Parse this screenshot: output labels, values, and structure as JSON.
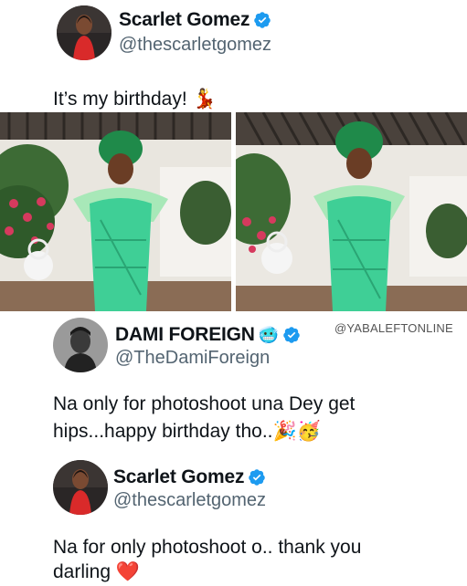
{
  "tweet1": {
    "name": "Scarlet Gomez",
    "handle": "@thescarletgomez",
    "text": "It’s my birthday! 💃"
  },
  "tweet2": {
    "name": "DAMI FOREIGN",
    "name_emoji": "🥶",
    "handle": "@TheDamiForeign",
    "text_line1": "Na only for photoshoot una Dey get",
    "text_line2": "hips...happy birthday tho..🎉🥳"
  },
  "tweet3": {
    "name": "Scarlet Gomez",
    "handle": "@thescarletgomez",
    "text_line1": "Na for only photoshoot o.. thank you",
    "text_line2": "darling ❤️"
  },
  "watermark": "@YABALEFTONLINE",
  "colors": {
    "verified_blue": "#1d9bf0",
    "dress_green": "#3fcf96",
    "handle_gray": "#536471"
  },
  "icons": [
    "verified-badge-icon"
  ]
}
